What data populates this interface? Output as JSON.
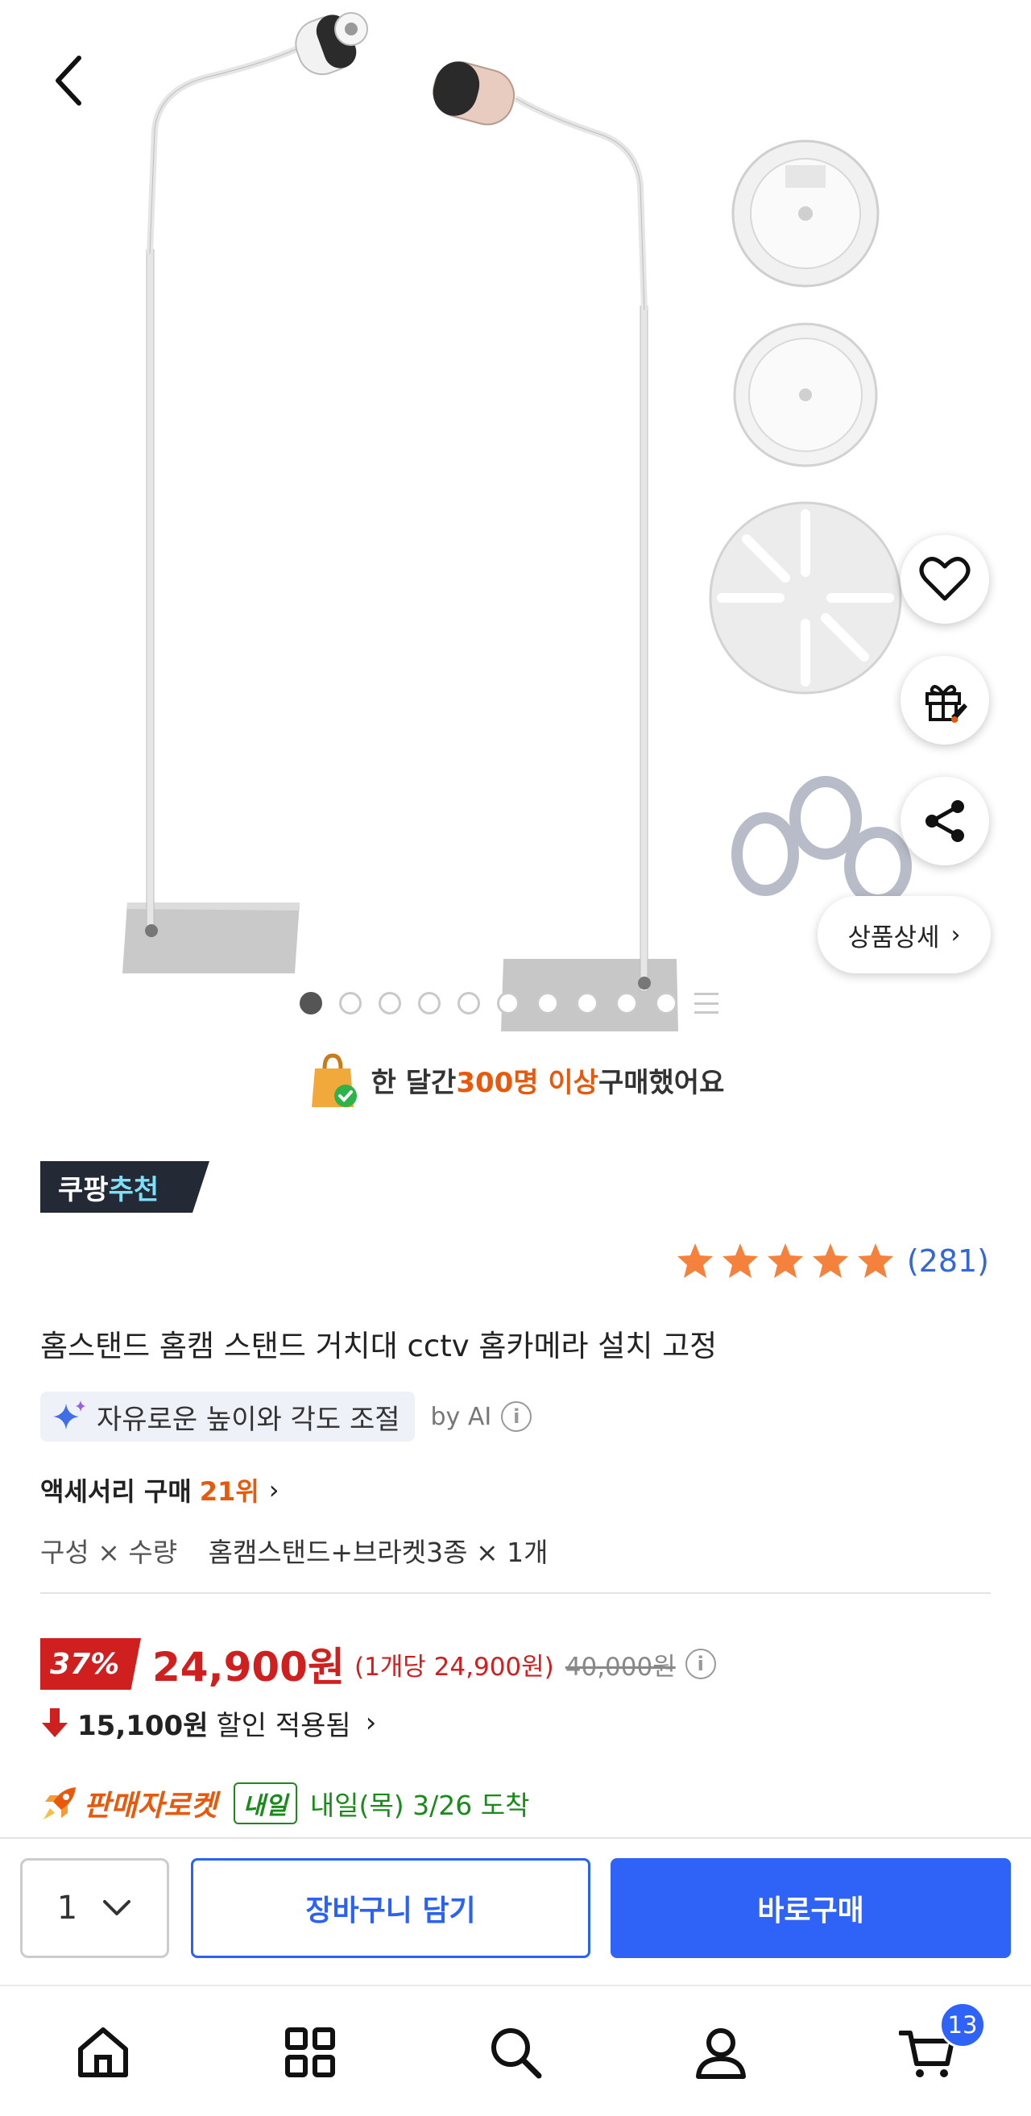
{
  "product_gallery": {
    "image_alt": "",
    "image_count": 10,
    "current_index": 1
  },
  "actions": {
    "detail_label": "상품상세"
  },
  "buyers_banner": {
    "prefix": "한 달간 ",
    "highlight": "300명 이상",
    "suffix": " 구매했어요"
  },
  "recommend_badge": {
    "part1": "쿠팡",
    "part2": "추천"
  },
  "rating": {
    "stars": 5,
    "count": "(281)"
  },
  "product": {
    "title": "홈스탠드 홈캠 스탠드 거치대 cctv 홈카메라 설치 고정",
    "ai_summary": "자유로운 높이와 각도 조절",
    "ai_by": "by AI",
    "rank_category": "액세서리 구매",
    "rank_value": "21위",
    "option_label": "구성 × 수량",
    "option_value": "홈캠스탠드+브라켓3종 × 1개"
  },
  "pricing": {
    "discount": "37%",
    "price": "24,900원",
    "unit_price": "(1개당 24,900원)",
    "original_price": "40,000원",
    "coupon_amount": "15,100원",
    "coupon_label": "할인 적용됨"
  },
  "delivery": {
    "type": "판매자로켓",
    "day_badge": "내일",
    "arrival": "내일(목) 3/26 도착"
  },
  "purchase_bar": {
    "quantity": "1",
    "cart_label": "장바구니 담기",
    "buy_label": "바로구매"
  },
  "bottom_nav": {
    "cart_badge": "13",
    "items": [
      "home-icon",
      "category-icon",
      "search-icon",
      "my-icon",
      "cart-icon"
    ]
  },
  "colors": {
    "accent_blue": "#2f62f7",
    "price_red": "#cf1f1f",
    "rank_orange": "#e8590c",
    "delivery_green": "#1a8a1a",
    "star_orange": "#f5823c"
  }
}
